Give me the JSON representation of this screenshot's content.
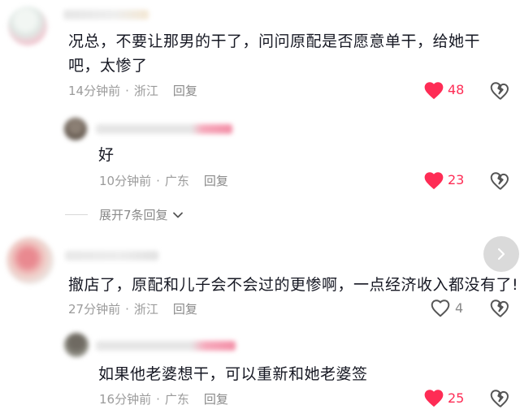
{
  "colors": {
    "like_active": "#fe2c55",
    "muted_text": "#9b9b9b",
    "main_text": "#161823"
  },
  "comments": [
    {
      "text": "况总，不要让那男的干了，问问原配是否愿意单干，给她干吧，太惨了",
      "time": "14分钟前",
      "location": "浙江",
      "reply_label": "回复",
      "like_count": "48",
      "liked": true,
      "reply": {
        "text": "好",
        "time": "10分钟前",
        "location": "广东",
        "reply_label": "回复",
        "like_count": "23",
        "liked": true
      },
      "expand_label": "展开7条回复"
    },
    {
      "text": "撤店了，原配和儿子会不会过的更惨啊，一点经济收入都没有了!",
      "time": "27分钟前",
      "location": "浙江",
      "reply_label": "回复",
      "like_count": "4",
      "liked": false,
      "reply": {
        "text": "如果他老婆想干，可以重新和她老婆签",
        "time": "16分钟前",
        "location": "广东",
        "reply_label": "回复",
        "like_count": "25",
        "liked": true
      }
    }
  ],
  "icons": {
    "like": "heart-icon",
    "dislike": "broken-heart-icon",
    "expand": "chevron-down-icon",
    "scroll": "chevron-right-icon"
  }
}
